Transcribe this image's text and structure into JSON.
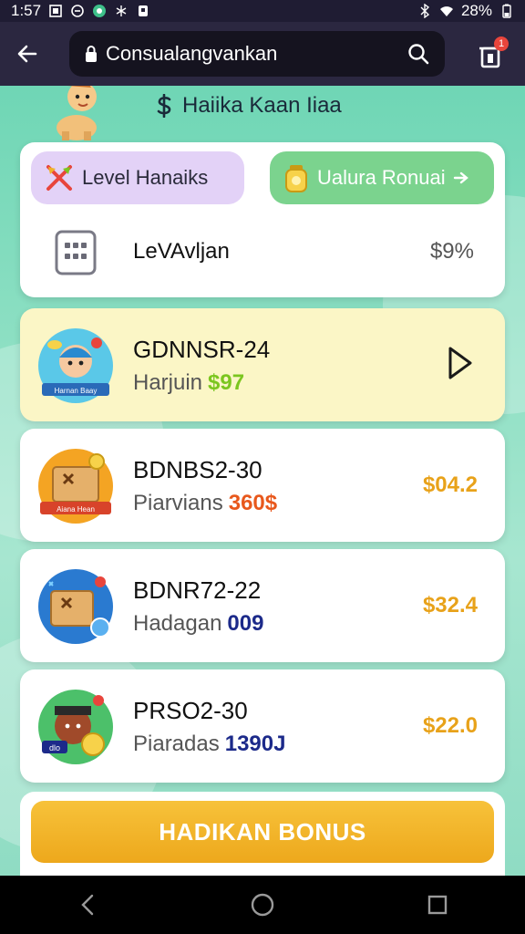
{
  "status_bar": {
    "time": "1:57",
    "battery": "28%",
    "icons": [
      "screenshot-icon",
      "vpn-icon",
      "app-icon",
      "sync-icon",
      "notification-icon",
      "bluetooth-icon",
      "wifi-icon",
      "battery-icon"
    ]
  },
  "browser": {
    "url": "Consualangvankan",
    "tab_count": "1"
  },
  "page": {
    "title": "Haiika Kaan Iiaa",
    "top_card": {
      "level_pill": "Level Hanaiks",
      "value_pill": "Ualura Ronuai",
      "level_name": "LeVAvljan",
      "level_pct": "$9%"
    },
    "items": [
      {
        "code": "GDNNSR-24",
        "sub_label": "Harjuin",
        "sub_value": "$97",
        "amount": "",
        "active": true,
        "badge": "Harnan Baay"
      },
      {
        "code": "BDNBS2-30",
        "sub_label": "Piarvians",
        "sub_value": "360$",
        "amount": "$04.2",
        "active": false,
        "badge": "Aiana Hean"
      },
      {
        "code": "BDNR72-22",
        "sub_label": "Hadagan",
        "sub_value": "009",
        "amount": "$32.4",
        "active": false,
        "badge": ""
      },
      {
        "code": "PRSO2-30",
        "sub_label": "Piaradas",
        "sub_value": "1390J",
        "amount": "$22.0",
        "active": false,
        "badge": "dlo"
      }
    ],
    "cta_label": "HADIKAN BONUS"
  },
  "colors": {
    "accent": "#f0b22a",
    "page_bg": "#8fe0c4",
    "active_row": "#fbf6c6",
    "pill_purple": "#e3d2f7",
    "pill_green": "#7bd38e",
    "sub_colors": [
      "#7bc61f",
      "#e8581c",
      "#1c2a8a",
      "#1c2a8a"
    ]
  }
}
